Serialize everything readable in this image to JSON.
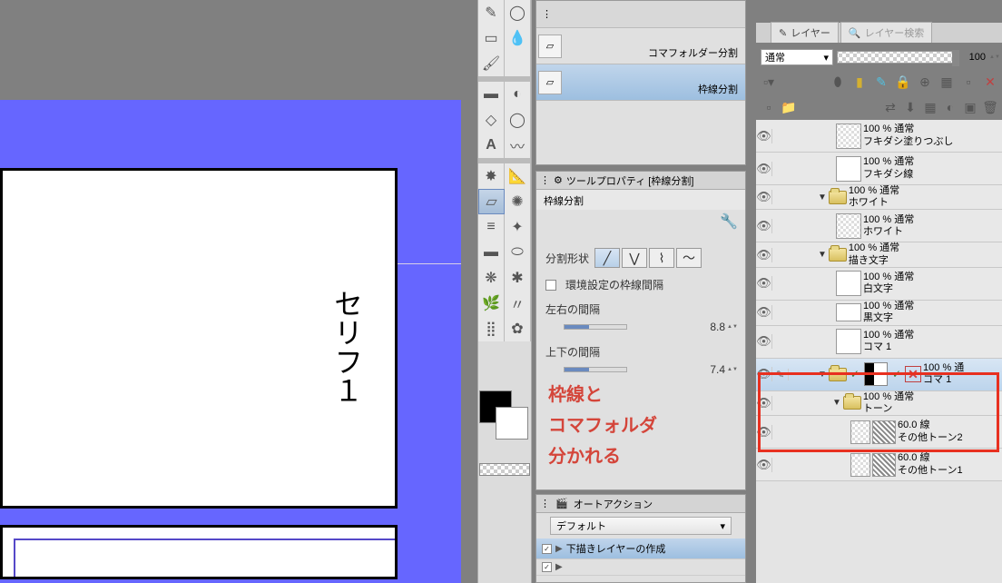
{
  "canvas": {
    "serif_text": "セリフ１"
  },
  "subtool": {
    "items": [
      {
        "label": "コマフォルダー分割"
      },
      {
        "label": "枠線分割"
      }
    ]
  },
  "toolprop": {
    "header": "ツールプロパティ [枠線分割]",
    "title": "枠線分割",
    "shape_label": "分割形状",
    "env_label": "環境設定の枠線間隔",
    "lr_label": "左右の間隔",
    "lr_val": "8.8",
    "tb_label": "上下の間隔",
    "tb_val": "7.4"
  },
  "annotation": {
    "line1": "枠線と",
    "line2": "コマフォルダ",
    "line3": "分かれる"
  },
  "autoaction": {
    "header": "オートアクション",
    "set": "デフォルト",
    "item1": "下描きレイヤーの作成"
  },
  "layers": {
    "tab1": "レイヤー",
    "tab2": "レイヤー検索",
    "blend": "通常",
    "opacity": "100",
    "items": [
      {
        "opacity": "100 % 通常",
        "name": "フキダシ塗りつぶし"
      },
      {
        "opacity": "100 % 通常",
        "name": "フキダシ線"
      },
      {
        "opacity": "100 % 通常",
        "name": "ホワイト"
      },
      {
        "opacity": "100 % 通常",
        "name": "ホワイト"
      },
      {
        "opacity": "100 % 通常",
        "name": "描き文字"
      },
      {
        "opacity": "100 % 通常",
        "name": "白文字"
      },
      {
        "opacity": "100 % 通常",
        "name": "黒文字"
      },
      {
        "opacity": "100 % 通常",
        "name": "コマ 1"
      },
      {
        "opacity": "100 % 通",
        "name": "コマ 1"
      },
      {
        "opacity": "100 % 通常",
        "name": "トーン"
      },
      {
        "opacity": "60.0 線",
        "name": "その他トーン2"
      },
      {
        "opacity": "60.0 線",
        "name": "その他トーン1"
      }
    ]
  }
}
